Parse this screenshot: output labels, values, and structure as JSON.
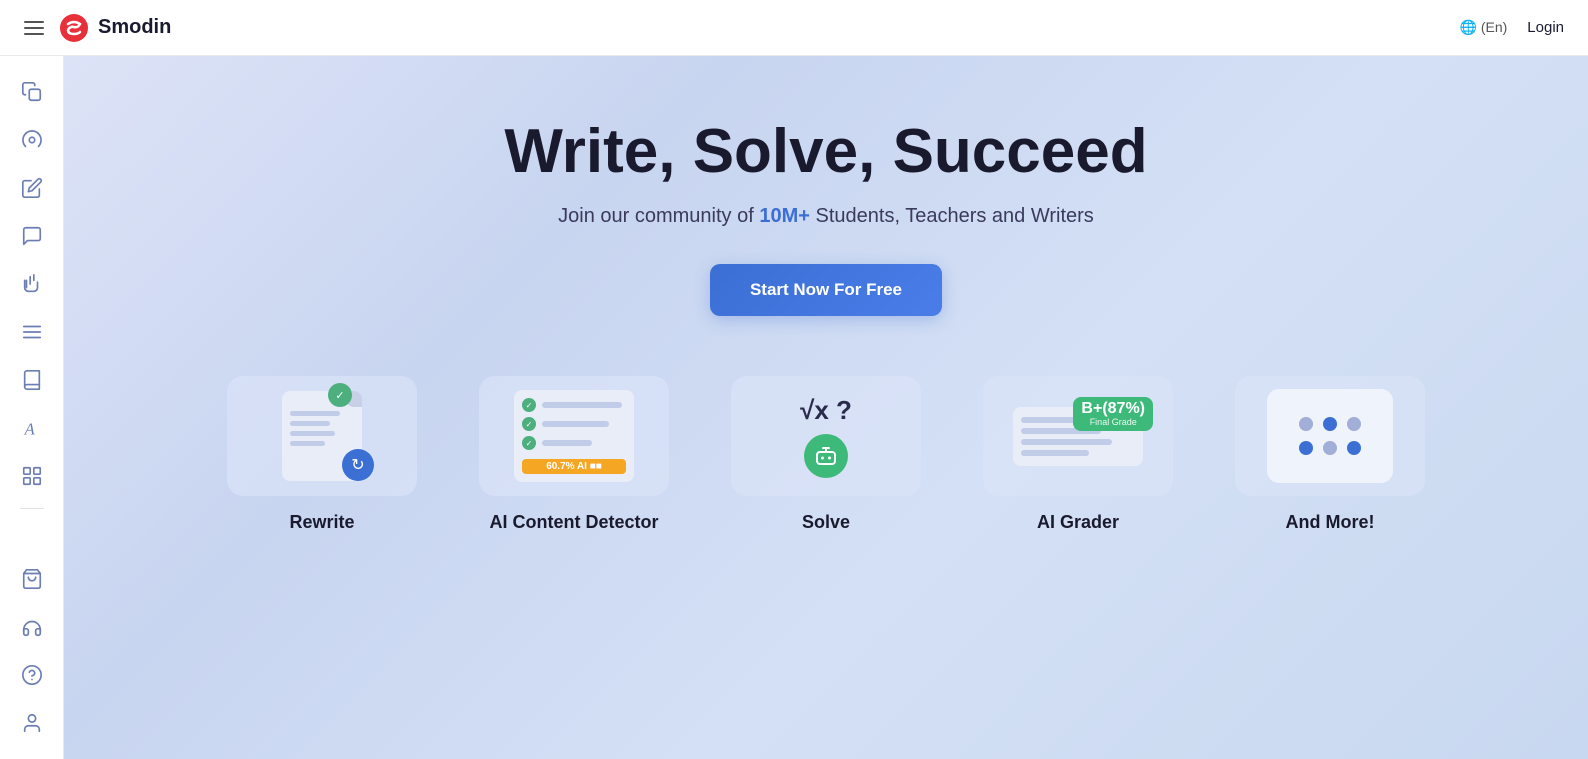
{
  "navbar": {
    "logo_text": "Smodin",
    "lang_label": "🌐 (En)",
    "login_label": "Login"
  },
  "sidebar": {
    "icons": [
      {
        "name": "copy-icon",
        "symbol": "⧉"
      },
      {
        "name": "chat-bubble-icon",
        "symbol": "💬"
      },
      {
        "name": "pencil-icon",
        "symbol": "✏️"
      },
      {
        "name": "message-icon",
        "symbol": "🗨"
      },
      {
        "name": "hand-icon",
        "symbol": "✋"
      },
      {
        "name": "list-icon",
        "symbol": "≡"
      },
      {
        "name": "book-icon",
        "symbol": "📖"
      },
      {
        "name": "text-icon",
        "symbol": "A"
      },
      {
        "name": "grid-icon",
        "symbol": "⊞"
      }
    ],
    "bottom_icons": [
      {
        "name": "cart-icon",
        "symbol": "🛒"
      },
      {
        "name": "headset-icon",
        "symbol": "🎧"
      },
      {
        "name": "help-icon",
        "symbol": "?"
      },
      {
        "name": "user-icon",
        "symbol": "👤"
      }
    ]
  },
  "hero": {
    "title_part1": "Write, Solve, ",
    "title_bold": "Succeed",
    "subtitle_prefix": "Join our community of ",
    "subtitle_highlight": "10M+",
    "subtitle_suffix": " Students, Teachers and Writers",
    "cta_label": "Start Now For Free"
  },
  "features": [
    {
      "id": "rewrite",
      "label": "Rewrite"
    },
    {
      "id": "ai-content-detector",
      "label": "AI Content Detector"
    },
    {
      "id": "solve",
      "label": "Solve"
    },
    {
      "id": "ai-grader",
      "label": "AI Grader"
    },
    {
      "id": "and-more",
      "label": "And More!"
    }
  ]
}
